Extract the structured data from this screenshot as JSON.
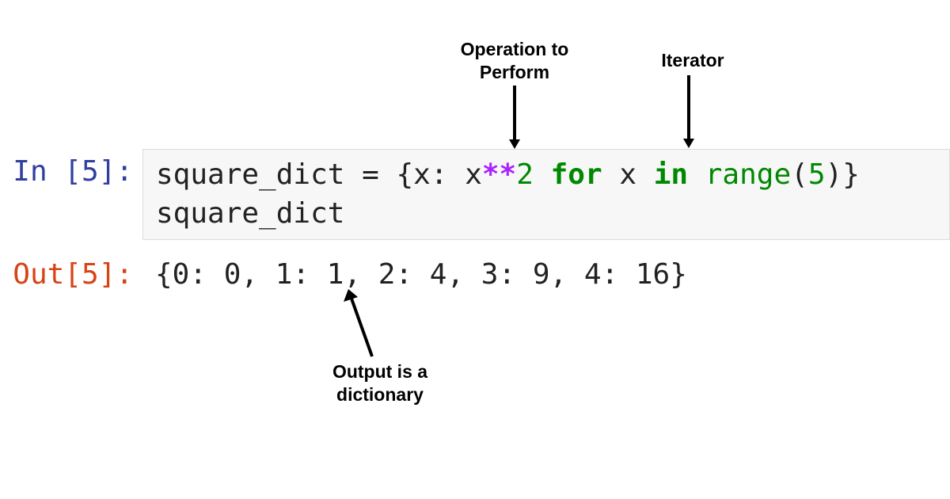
{
  "annotations": {
    "operation": "Operation to\nPerform",
    "iterator": "Iterator",
    "output": "Output is a\ndictionary"
  },
  "cell": {
    "in_prompt": "In [5]:",
    "out_prompt": "Out[5]:",
    "code": {
      "var": "square_dict",
      "assign": " = ",
      "lbrace": "{",
      "key": "x",
      "colon": ": ",
      "xbase": "x",
      "pow": "**",
      "two": "2",
      "sp1": " ",
      "for": "for",
      "sp2": " ",
      "loopvar": "x",
      "sp3": " ",
      "in": "in",
      "sp4": " ",
      "range": "range",
      "lparen": "(",
      "five": "5",
      "rparen": ")",
      "rbrace": "}",
      "line2": "square_dict"
    },
    "output": "{0: 0, 1: 1, 2: 4, 3: 9, 4: 16}"
  }
}
